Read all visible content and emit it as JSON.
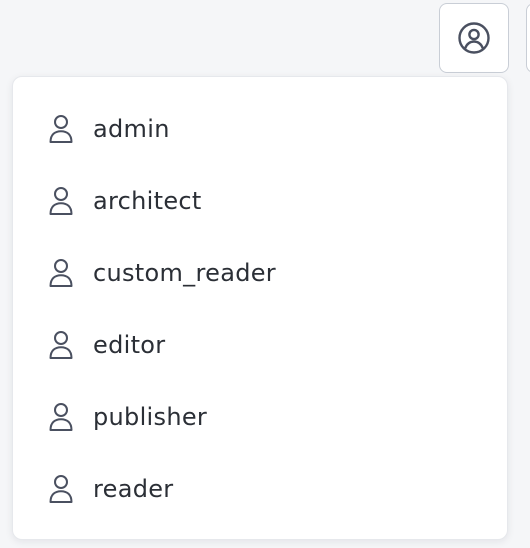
{
  "header": {
    "user_button_icon": "user-circle-icon"
  },
  "menu": {
    "items": [
      {
        "label": "admin",
        "icon": "person-icon"
      },
      {
        "label": "architect",
        "icon": "person-icon"
      },
      {
        "label": "custom_reader",
        "icon": "person-icon"
      },
      {
        "label": "editor",
        "icon": "person-icon"
      },
      {
        "label": "publisher",
        "icon": "person-icon"
      },
      {
        "label": "reader",
        "icon": "person-icon"
      }
    ]
  },
  "colors": {
    "icon_stroke": "#4a5060",
    "text": "#2b2f36",
    "border": "#c9ced6"
  }
}
